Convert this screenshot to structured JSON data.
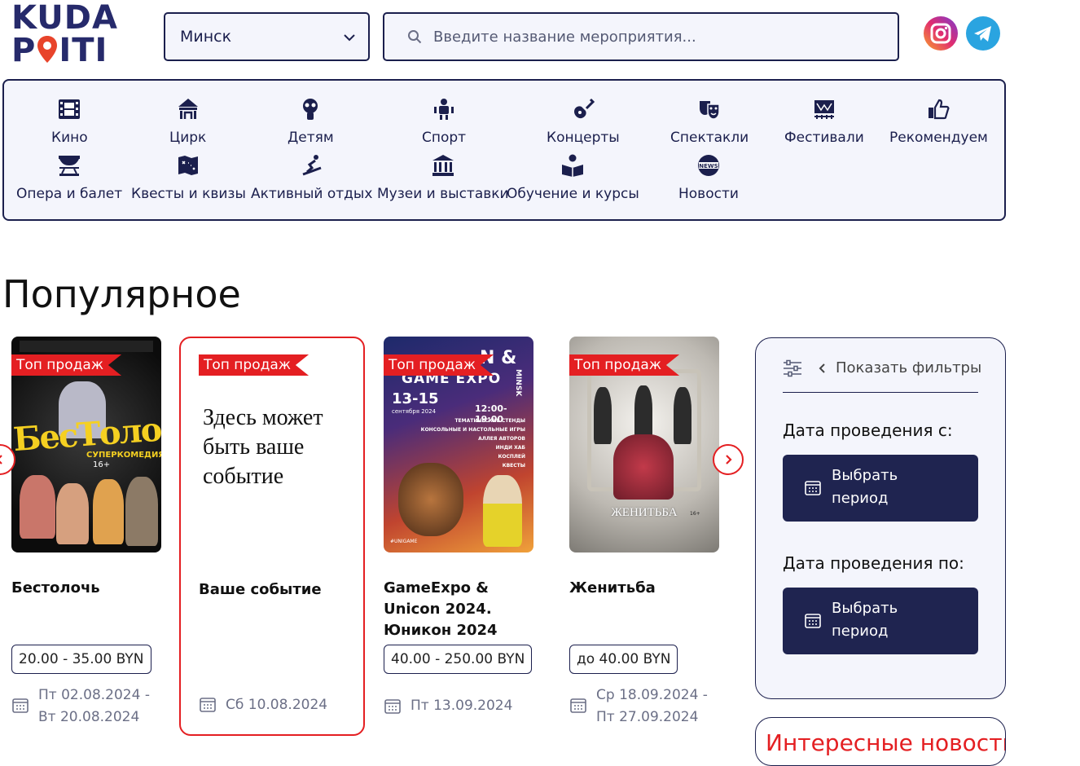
{
  "logo": {
    "line1": "KUDA",
    "line2_a": "P",
    "line2_b": "ITI"
  },
  "city": {
    "value": "Минск"
  },
  "search": {
    "placeholder": "Введите название мероприятия..."
  },
  "social": {
    "instagram": "instagram-icon",
    "telegram": "telegram-icon"
  },
  "categories": [
    {
      "label": "Кино",
      "icon": "film-icon"
    },
    {
      "label": "Цирк",
      "icon": "circus-icon"
    },
    {
      "label": "Детям",
      "icon": "kids-icon"
    },
    {
      "label": "Спорт",
      "icon": "sport-icon"
    },
    {
      "label": "Концерты",
      "icon": "guitar-icon"
    },
    {
      "label": "Спектакли",
      "icon": "theatre-masks-icon"
    },
    {
      "label": "Фестивали",
      "icon": "festival-icon"
    },
    {
      "label": "Рекомендуем",
      "icon": "thumbs-up-icon"
    },
    {
      "label": "Опера и балет",
      "icon": "opera-icon"
    },
    {
      "label": "Квесты и квизы",
      "icon": "quest-map-icon"
    },
    {
      "label": "Активный отдых",
      "icon": "active-rest-icon"
    },
    {
      "label": "Музеи и выставки",
      "icon": "museum-icon"
    },
    {
      "label": "Обучение и курсы",
      "icon": "reading-icon"
    },
    {
      "label": "Новости",
      "icon": "news-icon"
    }
  ],
  "popular": {
    "heading": "Популярное",
    "badge": "Топ продаж"
  },
  "cards": [
    {
      "title": "Бестолочь",
      "price": "20.00 - 35.00 BYN",
      "date1": "Пт 02.08.2024 -",
      "date2": "Вт 20.08.2024",
      "poster_title": "БесТолочь",
      "poster_sub": "СУПЕРКОМЕДИЯ",
      "poster_age": "16+"
    },
    {
      "title": "Ваше событие",
      "placeholder": "Здесь может быть ваше событие",
      "date1": "Сб 10.08.2024"
    },
    {
      "title": "GameExpo & Unicon 2024. Юникон 2024",
      "price": "40.00 - 250.00 BYN",
      "date1": "Пт 13.09.2024",
      "poster_title": "GAME EXPO",
      "poster_dates": "13-15",
      "poster_month": "сентября 2024",
      "poster_time": "12:00-19:00",
      "poster_list": [
        "ТЕМАТИЧЕСКИЕ СТЕНДЫ",
        "КОНСОЛЬНЫЕ И НАСТОЛЬНЫЕ ИГРЫ",
        "АЛЛЕЯ АВТОРОВ",
        "ИНДИ ХАБ",
        "КОСПЛЕЙ",
        "КВЕСТЫ"
      ],
      "poster_tag": "#UNIGAME",
      "poster_top": "N &",
      "poster_side": "MINSK"
    },
    {
      "title": "Женитьба",
      "price": "до 40.00 BYN",
      "date1": "Ср 18.09.2024 -",
      "date2": "Пт 27.09.2024",
      "poster_title": "ЖЕНИТЬБА",
      "poster_age": "16+"
    }
  ],
  "filters": {
    "toggle": "Показать фильтры",
    "from_label": "Дата проведения с:",
    "to_label": "Дата проведения по:",
    "btn_line1": "Выбрать",
    "btn_line2": "период"
  },
  "news_box": {
    "title": "Интересные новости"
  },
  "colors": {
    "navy": "#1b1f4d",
    "accent": "#e41f22",
    "panel": "#f4f5fc"
  }
}
